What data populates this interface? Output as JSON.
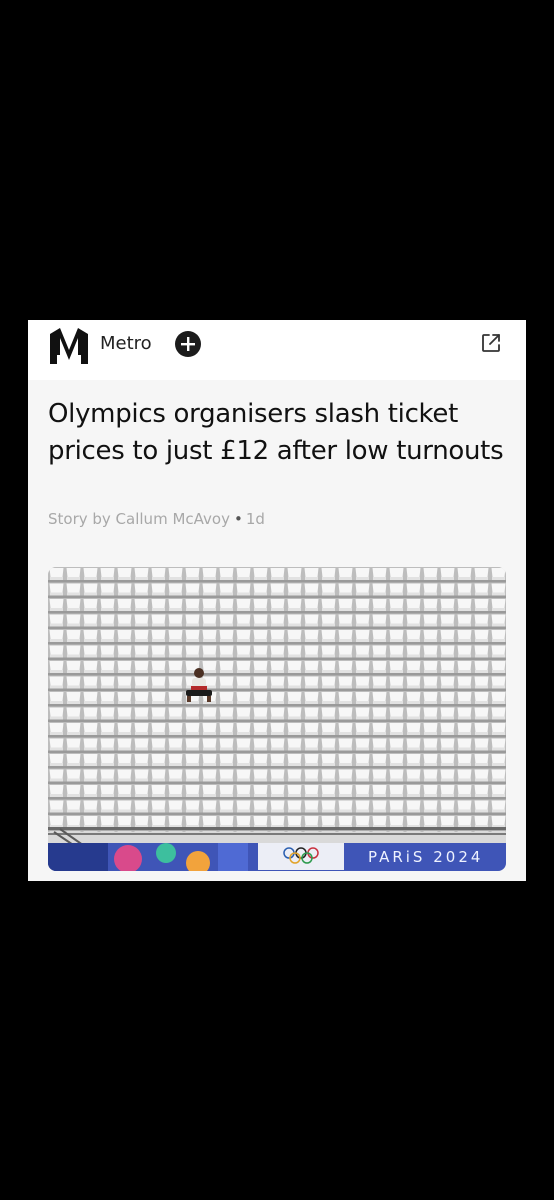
{
  "source": {
    "name": "Metro"
  },
  "article": {
    "title": "Olympics organisers slash ticket prices to just £12 after low turnouts",
    "byline": "Story by Callum McAvoy",
    "age": "1d"
  },
  "image": {
    "banner_text": "PARiS 2024"
  },
  "icons": {
    "logo": "metro-logo-icon",
    "follow": "plus-icon",
    "share": "external-link-icon",
    "rings": "olympic-rings-icon"
  },
  "colors": {
    "background": "#000000",
    "card": "#ffffff",
    "content_bg": "#f6f6f6",
    "byline": "#a8a8a8",
    "banner_blue": "#3f55b7"
  }
}
